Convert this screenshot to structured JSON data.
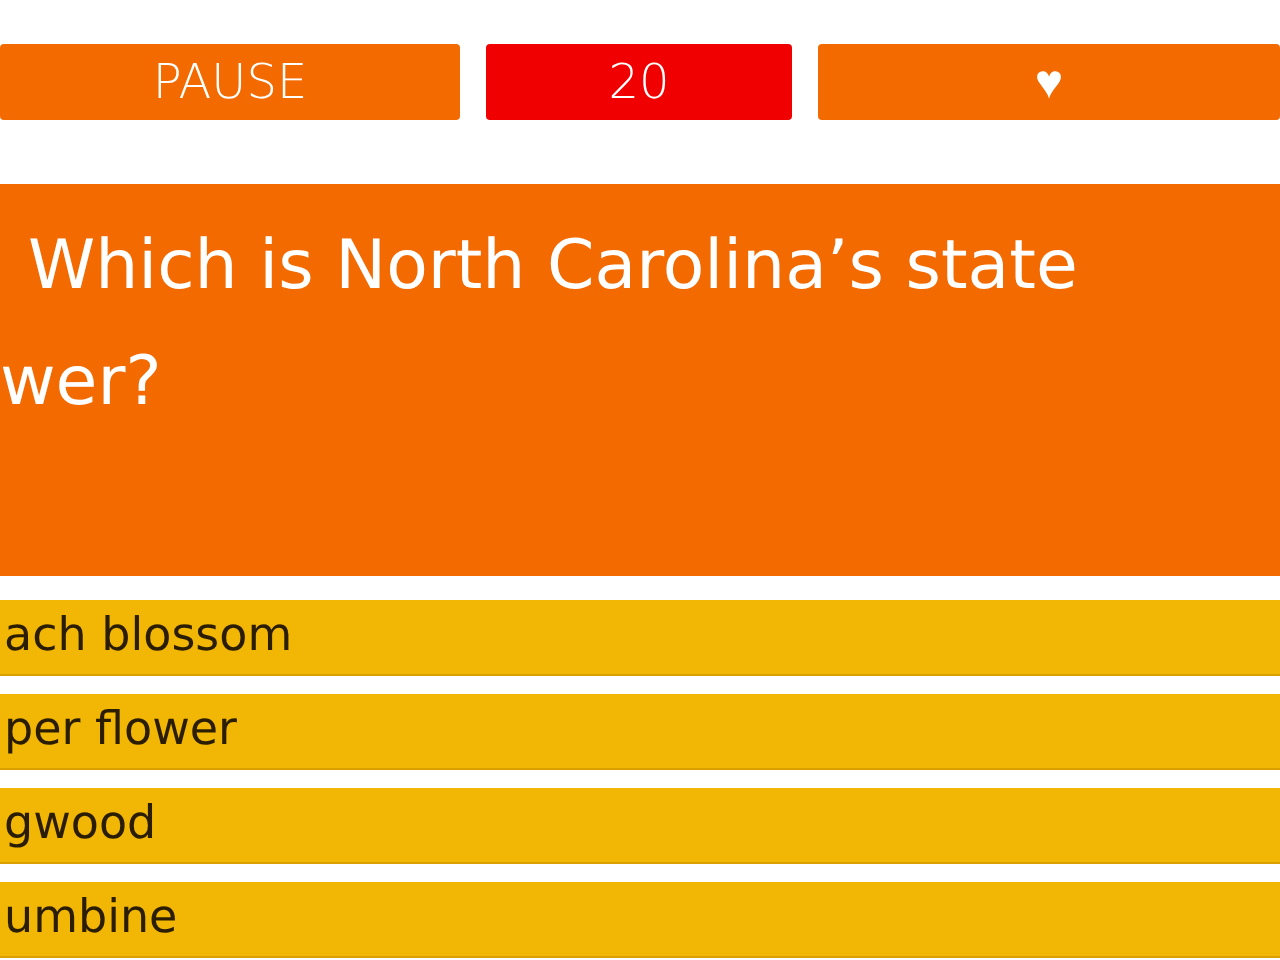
{
  "top_bar": {
    "pause": "PAUSE",
    "timer": "20",
    "lives": "♥"
  },
  "question": {
    "lines": [
      "Which is North Carolina’s state",
      "wer?"
    ]
  },
  "answers": [
    {
      "label": "ach blossom"
    },
    {
      "label": "per flower"
    },
    {
      "label": "gwood"
    },
    {
      "label": "umbine"
    }
  ]
}
